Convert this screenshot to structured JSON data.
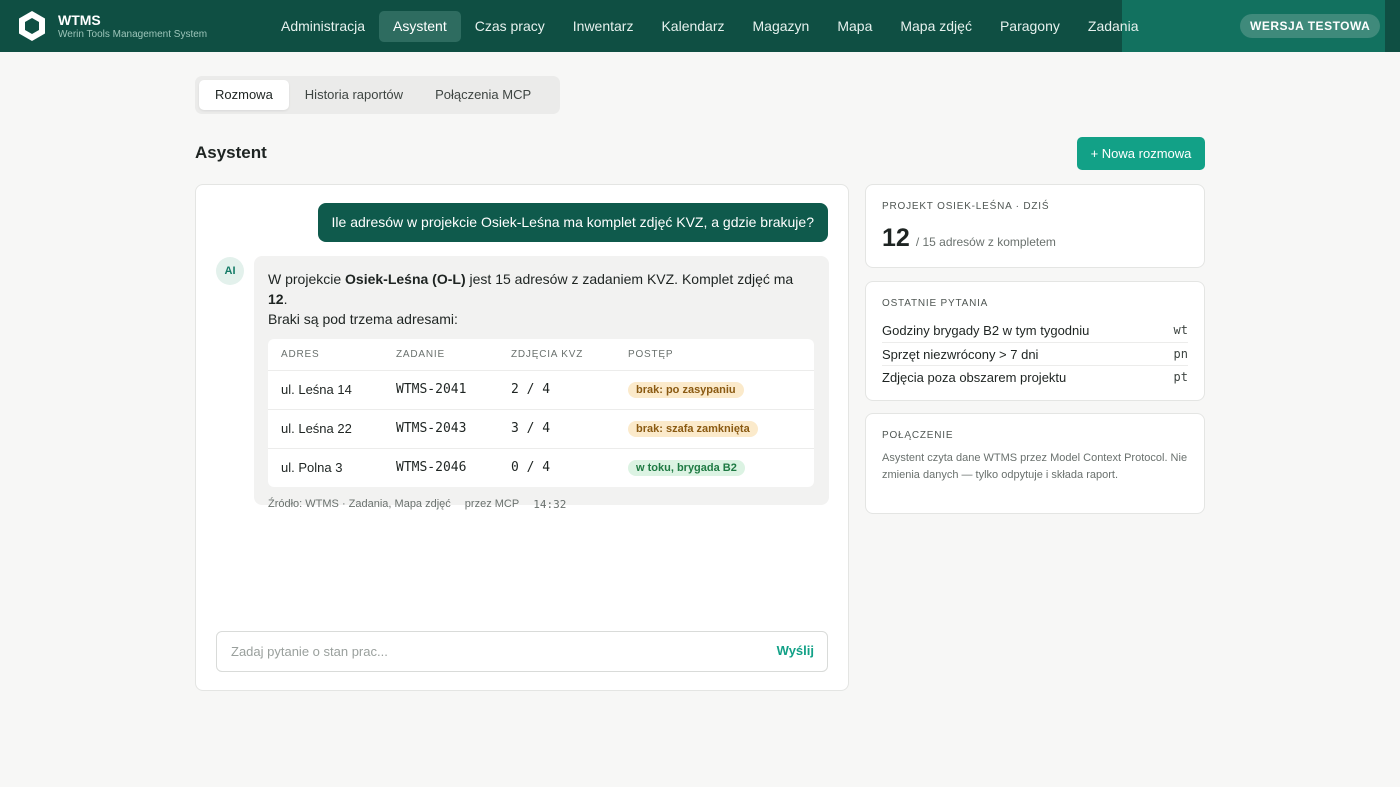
{
  "header": {
    "brand_name": "WTMS",
    "brand_sub": "Werin Tools Management System",
    "nav": [
      {
        "label": "Administracja"
      },
      {
        "label": "Asystent",
        "active": true
      },
      {
        "label": "Czas pracy"
      },
      {
        "label": "Inwentarz"
      },
      {
        "label": "Kalendarz"
      },
      {
        "label": "Magazyn"
      },
      {
        "label": "Mapa"
      },
      {
        "label": "Mapa zdjęć"
      },
      {
        "label": "Paragony"
      },
      {
        "label": "Zadania"
      }
    ],
    "test_badge": "WERSJA TESTOWA"
  },
  "tabs": [
    {
      "label": "Rozmowa",
      "active": true
    },
    {
      "label": "Historia raportów"
    },
    {
      "label": "Połączenia MCP"
    }
  ],
  "page_title": "Asystent",
  "new_chat_label": "+ Nowa rozmowa",
  "chat": {
    "user_message": "Ile adresów w projekcie Osiek-Leśna ma komplet zdjęć KVZ, a gdzie brakuje?",
    "ai_avatar": "AI",
    "ai_text": {
      "p1": "W projekcie ",
      "project": "Osiek-Leśna (O-L)",
      "p2": " jest 15 adresów z zadaniem KVZ. Komplet zdjęć ma ",
      "count": "12",
      "p3": ".",
      "p4": "Braki są pod trzema adresami:"
    },
    "table": {
      "headers": [
        "ADRES",
        "ZADANIE",
        "ZDJĘCIA KVZ",
        "POSTĘP"
      ],
      "rows": [
        {
          "address": "ul. Leśna 14",
          "task": "WTMS-2041",
          "photos": "2 / 4",
          "status": "brak: po zasypaniu",
          "status_type": "warn"
        },
        {
          "address": "ul. Leśna 22",
          "task": "WTMS-2043",
          "photos": "3 / 4",
          "status": "brak: szafa zamknięta",
          "status_type": "warn"
        },
        {
          "address": "ul. Polna 3",
          "task": "WTMS-2046",
          "photos": "0 / 4",
          "status": "w toku, brygada B2",
          "status_type": "ok"
        }
      ]
    },
    "source": "Źródło: WTMS · Zadania, Mapa zdjęć",
    "via": "przez MCP",
    "time": "14:32",
    "input_placeholder": "Zadaj pytanie o stan prac...",
    "send_label": "Wyślij"
  },
  "side": {
    "project_card": {
      "label": "PROJEKT OSIEK-LEŚNA · DZIŚ",
      "value": "12",
      "sub": "/ 15 adresów z kompletem"
    },
    "recent": {
      "label": "OSTATNIE PYTANIA",
      "items": [
        {
          "text": "Godziny brygady B2 w tym tygodniu",
          "key": "wt"
        },
        {
          "text": "Sprzęt niezwrócony > 7 dni",
          "key": "pn"
        },
        {
          "text": "Zdjęcia poza obszarem projektu",
          "key": "pt"
        }
      ]
    },
    "connection": {
      "label": "POŁĄCZENIE",
      "text": "Asystent czyta dane WTMS przez Model Context Protocol. Nie zmienia danych — tylko odpytuje i składa raport."
    }
  },
  "colors": {
    "header": "#0f4f43",
    "accent": "#12a187",
    "user_bubble": "#0f5a4c"
  }
}
